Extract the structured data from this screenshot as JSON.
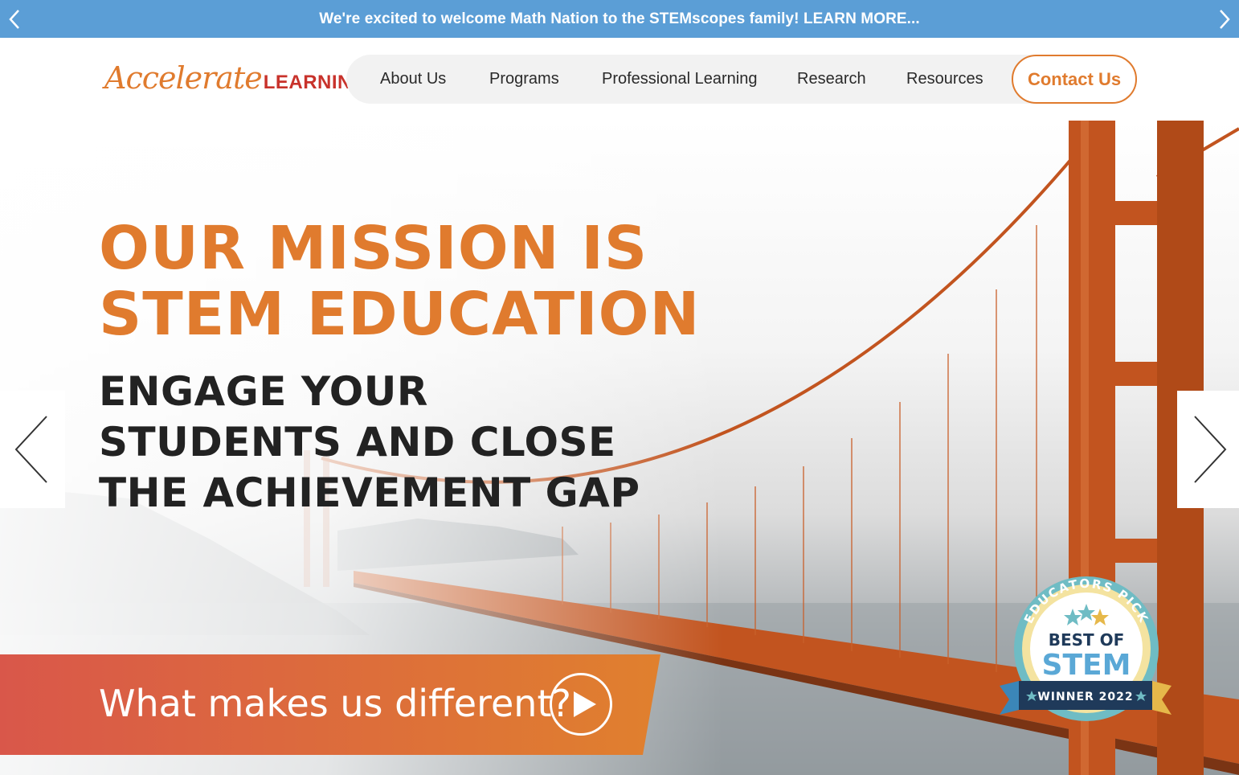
{
  "announcement": {
    "text": "We're excited to welcome Math Nation to the STEMscopes family! LEARN MORE...",
    "prev_icon": "chevron-left-icon",
    "next_icon": "chevron-right-icon"
  },
  "header": {
    "logo_script": "Accelerate",
    "logo_word": "LEARNING",
    "nav": [
      {
        "label": "About Us"
      },
      {
        "label": "Programs"
      },
      {
        "label": "Professional Learning"
      },
      {
        "label": "Research"
      },
      {
        "label": "Resources"
      }
    ],
    "contact_label": "Contact Us"
  },
  "hero": {
    "headline_line1": "OUR MISSION IS",
    "headline_line2": "STEM EDUCATION",
    "sub_line1": "ENGAGE YOUR",
    "sub_line2": "STUDENTS AND CLOSE",
    "sub_line3": "THE ACHIEVEMENT GAP",
    "cta_text": "What makes us different?",
    "play_icon": "play-icon",
    "prev_icon": "chevron-left-icon",
    "next_icon": "chevron-right-icon"
  },
  "badge": {
    "arc_text": "EDUCATORS PICK",
    "line1": "BEST OF",
    "line2": "STEM",
    "ribbon": "WINNER 2022"
  },
  "colors": {
    "accent_orange": "#e07b2e",
    "logo_red": "#c8322b",
    "announce_blue": "#5b9ed6",
    "text_dark": "#222222"
  }
}
